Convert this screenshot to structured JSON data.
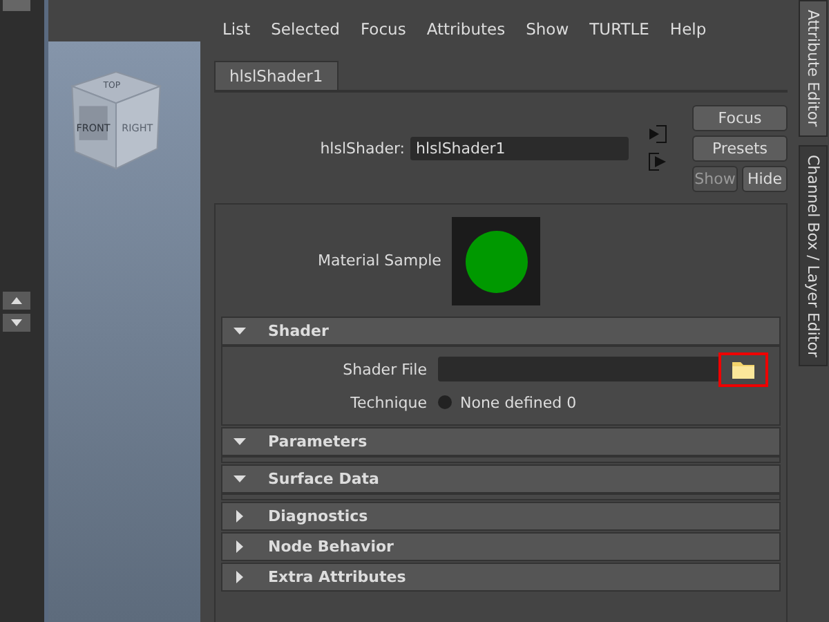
{
  "viewcube": {
    "labels": [
      "TOP",
      "FRONT",
      "RIGHT"
    ]
  },
  "menu": [
    "List",
    "Selected",
    "Focus",
    "Attributes",
    "Show",
    "TURTLE",
    "Help"
  ],
  "tabs": [
    {
      "label": "hlslShader1",
      "selected": true
    }
  ],
  "node": {
    "label": "hlslShader:",
    "value": "hlslShader1"
  },
  "buttons": [
    {
      "label": "Focus",
      "disabled": false
    },
    {
      "label": "Presets",
      "disabled": false
    }
  ],
  "show_hide": [
    {
      "label": "Show",
      "disabled": true
    },
    {
      "label": "Hide",
      "disabled": false
    }
  ],
  "material_sample": {
    "label": "Material Sample",
    "color": "#009900"
  },
  "sections": [
    {
      "title": "Shader",
      "expanded": true,
      "fields": [
        {
          "kind": "file",
          "label": "Shader File"
        },
        {
          "kind": "radio",
          "label": "Technique",
          "option": "None defined 0",
          "selected": false
        }
      ]
    },
    {
      "title": "Parameters",
      "expanded": true
    },
    {
      "title": "Surface Data",
      "expanded": true
    },
    {
      "title": "Diagnostics",
      "expanded": false
    },
    {
      "title": "Node Behavior",
      "expanded": false
    },
    {
      "title": "Extra Attributes",
      "expanded": false
    }
  ],
  "side_tabs": [
    {
      "label": "Attribute Editor",
      "selected": true
    },
    {
      "label": "Channel Box / Layer Editor",
      "selected": false
    }
  ]
}
